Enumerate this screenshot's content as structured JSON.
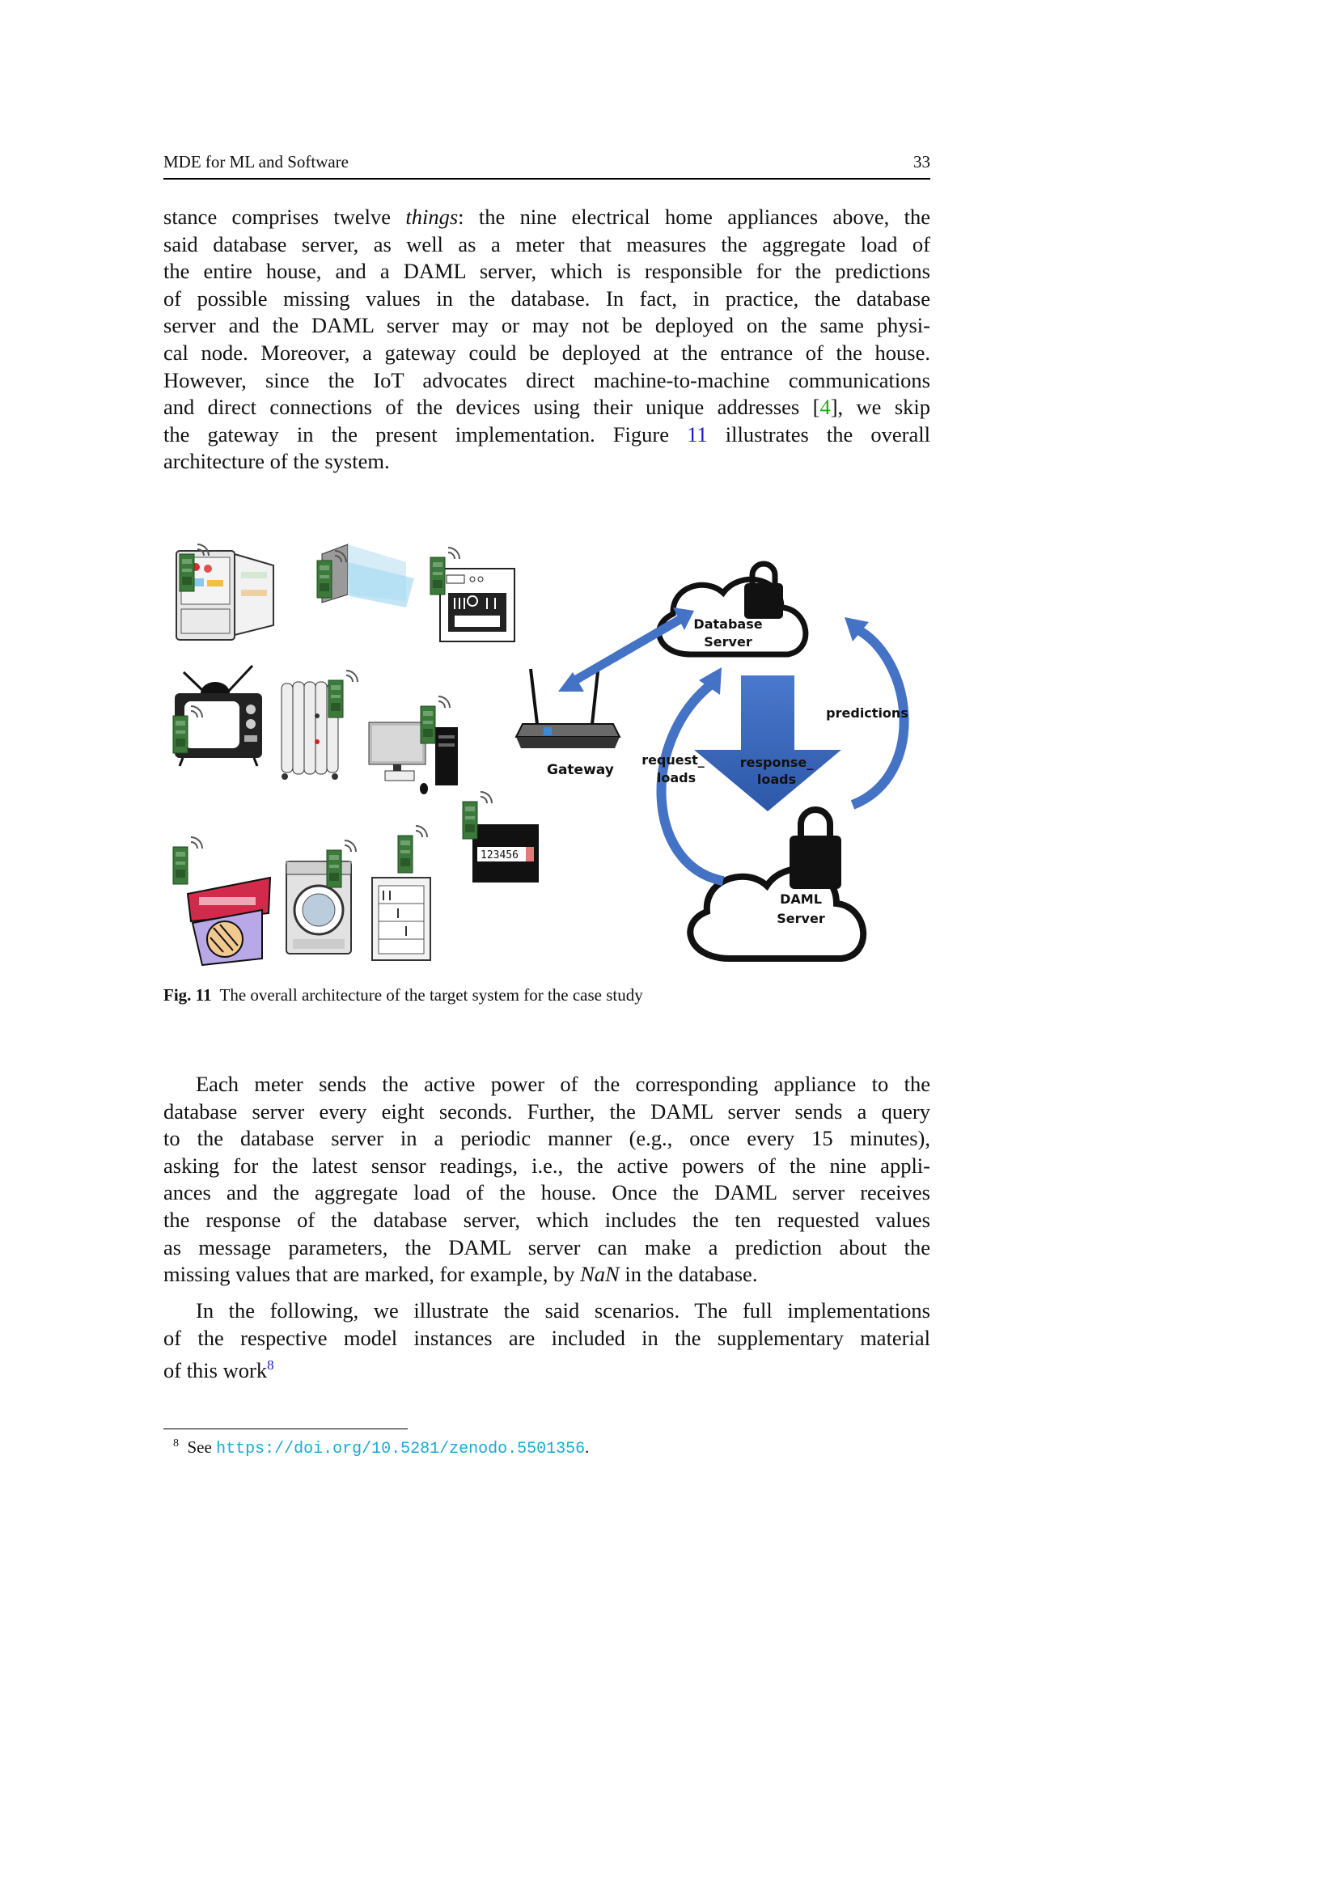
{
  "header": {
    "title": "MDE for ML and Software",
    "page_number": "33"
  },
  "paragraph1": {
    "lines": [
      [
        "stance comprises twelve ",
        {
          "em": "things"
        },
        ": the nine electrical home appliances above, the"
      ],
      [
        "said database server, as well as a meter that measures the aggregate load of"
      ],
      [
        "the entire house, and a DAML server, which is responsible for the predictions"
      ],
      [
        "of possible missing values in the database. In fact, in practice, the database"
      ],
      [
        "server and the DAML server may or may not be deployed on the same physi-"
      ],
      [
        "cal node. Moreover, a gateway could be deployed at the entrance of the house."
      ],
      [
        "However, since the IoT advocates direct machine-to-machine communications"
      ],
      [
        "and direct connections of the devices using their unique addresses [",
        {
          "ref_green": "4"
        },
        "], we skip"
      ],
      [
        "the gateway in the present implementation. Figure ",
        {
          "ref_blue": "11"
        },
        " illustrates the overall"
      ],
      [
        "architecture of the system."
      ]
    ]
  },
  "figure": {
    "labels": {
      "database_server_1": "Database",
      "database_server_2": "Server",
      "daml_server_1": "DAML",
      "daml_server_2": "Server",
      "gateway": "Gateway",
      "predictions": "predictions",
      "request_1": "request_",
      "request_2": "loads",
      "response_1": "response_",
      "response_2": "loads",
      "meter_digits": "123456"
    },
    "colors": {
      "arrow_blue": "#4472c4",
      "arrow_dark": "#2f55a4",
      "meter_board": "#3c7a3c"
    },
    "caption_label": "Fig. 11",
    "caption_text": "The overall architecture of the target system for the case study"
  },
  "paragraph2": {
    "lines": [
      [
        "Each meter sends the active power of the corresponding appliance to the"
      ],
      [
        "database server every eight seconds. Further, the DAML server sends a query"
      ],
      [
        "to the database server in a periodic manner (e.g., once every 15 minutes),"
      ],
      [
        "asking for the latest sensor readings, i.e., the active powers of the nine appli-"
      ],
      [
        "ances and the aggregate load of the house. Once the DAML server receives"
      ],
      [
        "the response of the database server, which includes the ten requested values"
      ],
      [
        "as message parameters, the DAML server can make a prediction about the"
      ],
      [
        "missing values that are marked, for example, by ",
        {
          "em": "NaN"
        },
        " in the database."
      ]
    ]
  },
  "paragraph3": {
    "lines": [
      [
        "In the following, we illustrate the said scenarios. The full implementations"
      ],
      [
        "of the respective model instances are included in the supplementary material"
      ],
      [
        "of this work",
        {
          "sup": "8"
        }
      ]
    ]
  },
  "footnote": {
    "mark": "8",
    "text_before": "See ",
    "url": "https://doi.org/10.5281/zenodo.5501356",
    "text_after": "."
  }
}
